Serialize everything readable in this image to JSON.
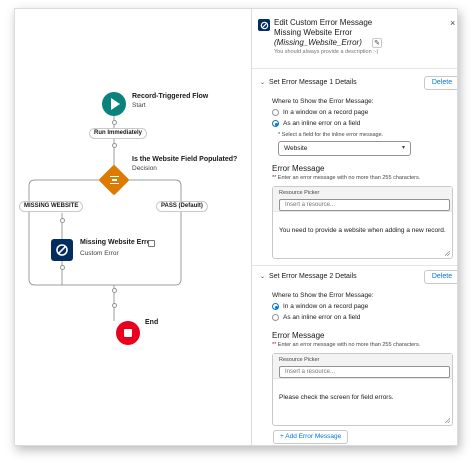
{
  "canvas": {
    "start": {
      "title": "Record-Triggered Flow",
      "subtitle": "Start"
    },
    "run_label": "Run Immediately",
    "decision": {
      "title": "Is the Website Field Populated?",
      "subtitle": "Decision"
    },
    "branch_left": "MISSING WEBSITE",
    "branch_right": "PASS (Default)",
    "error_node": {
      "title": "Missing Website Error",
      "subtitle": "Custom Error"
    },
    "end": {
      "title": "End"
    }
  },
  "panel": {
    "title": "Edit Custom Error Message",
    "name": "Missing Website Error",
    "api_name": "(Missing_Website_Error)",
    "description_hint": "You should always provide a description :-)",
    "close_icon": "close-icon",
    "sections": [
      {
        "heading": "Set Error Message 1 Details",
        "delete_label": "Delete",
        "where_label": "Where to Show the Error Message:",
        "option_record_page": "In a window on a record page",
        "option_inline": "As an inline error on a field",
        "selected": "inline",
        "field_hint": "* Select a field for the inline error message.",
        "field_value": "Website",
        "error_heading": "Error Message",
        "error_hint": "* Enter an error message with no more than 255 characters.",
        "picker_label": "Resource Picker",
        "picker_placeholder": "Insert a resource...",
        "message": "You need to provide a website when adding a new record."
      },
      {
        "heading": "Set Error Message 2 Details",
        "delete_label": "Delete",
        "where_label": "Where to Show the Error Message:",
        "option_record_page": "In a window on a record page",
        "option_inline": "As an inline error on a field",
        "selected": "record_page",
        "error_heading": "Error Message",
        "error_hint": "* Enter an error message with no more than 255 characters.",
        "picker_label": "Resource Picker",
        "picker_placeholder": "Insert a resource...",
        "message": "Please check the screen for field errors."
      }
    ],
    "add_label": "+ Add Error Message"
  },
  "colors": {
    "start": "#0b827c",
    "decision": "#dd7a01",
    "error_node": "#032d60",
    "end": "#ea001e",
    "link": "#0176d3"
  }
}
